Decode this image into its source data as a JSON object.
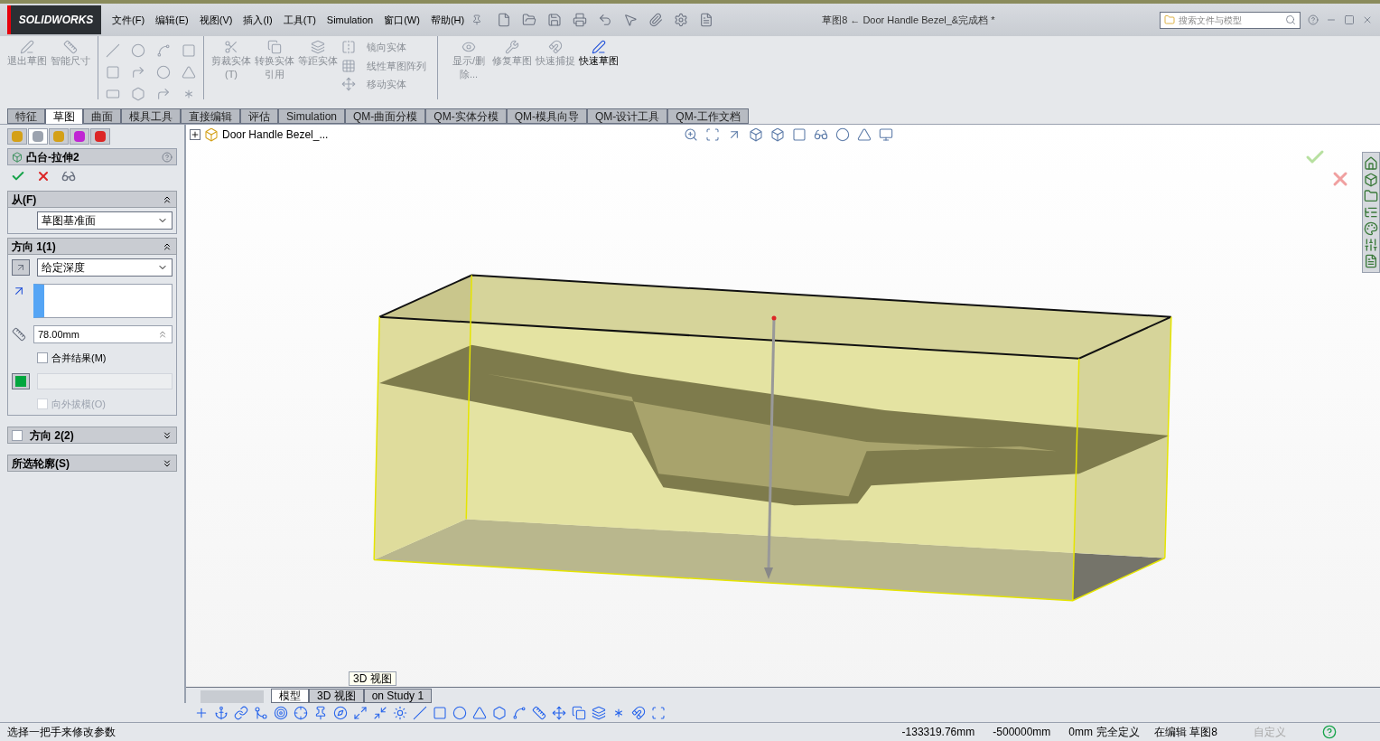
{
  "title_bar": {
    "logo": "SOLIDWORKS",
    "menus": [
      "文件(F)",
      "编辑(E)",
      "视图(V)",
      "插入(I)",
      "工具(T)",
      "Simulation",
      "窗口(W)",
      "帮助(H)"
    ],
    "document_title": "草图8 ← Door Handle Bezel_&完成档 *",
    "search": {
      "placeholder": "搜索文件与模型"
    }
  },
  "ribbon": {
    "items": [
      {
        "kind": "exit",
        "label": "退出草图",
        "disabled": true
      },
      {
        "kind": "dimension",
        "label": "智能尺寸",
        "disabled": true
      },
      {
        "kind": "trim",
        "label": "剪裁实体(T)",
        "disabled": true
      },
      {
        "kind": "convert",
        "label": "转换实体引用",
        "disabled": true
      },
      {
        "kind": "offset",
        "label": "等距实体",
        "disabled": true
      }
    ],
    "list_items": [
      {
        "kind": "mirror",
        "label": "镜向实体",
        "disabled": true
      },
      {
        "kind": "pattern",
        "label": "线性草图阵列",
        "disabled": true
      },
      {
        "kind": "move",
        "label": "移动实体",
        "disabled": true
      }
    ],
    "more_items": [
      {
        "kind": "display",
        "label": "显示/删除...",
        "disabled": true
      },
      {
        "kind": "repair",
        "label": "修复草图",
        "disabled": true
      },
      {
        "kind": "snap",
        "label": "快速捕捉",
        "disabled": true
      },
      {
        "kind": "quick",
        "label": "快速草图",
        "disabled": false
      }
    ]
  },
  "command_tabs": [
    {
      "label": "特征",
      "selected": false
    },
    {
      "label": "草图",
      "selected": true
    },
    {
      "label": "曲面",
      "selected": false
    },
    {
      "label": "模具工具",
      "selected": false
    },
    {
      "label": "直接编辑",
      "selected": false
    },
    {
      "label": "评估",
      "selected": false
    },
    {
      "label": "Simulation",
      "selected": false
    },
    {
      "label": "QM-曲面分模",
      "selected": false
    },
    {
      "label": "QM-实体分模",
      "selected": false
    },
    {
      "label": "QM-模具向导",
      "selected": false
    },
    {
      "label": "QM-设计工具",
      "selected": false
    },
    {
      "label": "QM-工作文档",
      "selected": false
    }
  ],
  "property_manager": {
    "panel_tabs": [
      {
        "kind": "tree",
        "selected": false
      },
      {
        "kind": "property",
        "selected": true
      },
      {
        "kind": "config",
        "selected": false
      },
      {
        "kind": "dimxpert",
        "selected": false
      },
      {
        "kind": "display",
        "selected": false
      }
    ],
    "title": "凸台-拉伸2",
    "from": {
      "heading": "从(F)",
      "expanded": true,
      "value": "草图基准面"
    },
    "direction1": {
      "heading": "方向 1(1)",
      "expanded": true,
      "end_condition": "给定深度",
      "depth": "78.00mm",
      "merge": {
        "label": "合并结果(M)",
        "checked": false
      },
      "draft": {
        "label": "向外拔模(O)",
        "checked": false,
        "disabled": true
      }
    },
    "direction2": {
      "heading": "方向 2(2)",
      "checked": false,
      "expanded": false
    },
    "selected_contours": {
      "heading": "所选轮廓(S)",
      "expanded": false
    }
  },
  "viewport": {
    "tree_root": "Door Handle Bezel_..."
  },
  "bottom_tabs": [
    {
      "label": "模型",
      "selected": true
    },
    {
      "label": "3D 视图",
      "selected": false
    },
    {
      "label": "on Study 1",
      "selected": false
    }
  ],
  "tooltip": "3D 视图",
  "status_bar": {
    "message": "选择一把手来修改参数",
    "x": "-133319.76mm",
    "y": "-500000mm",
    "z": "0mm",
    "definition": "完全定义",
    "editing": "在编辑 草图8",
    "custom": "自定义"
  }
}
